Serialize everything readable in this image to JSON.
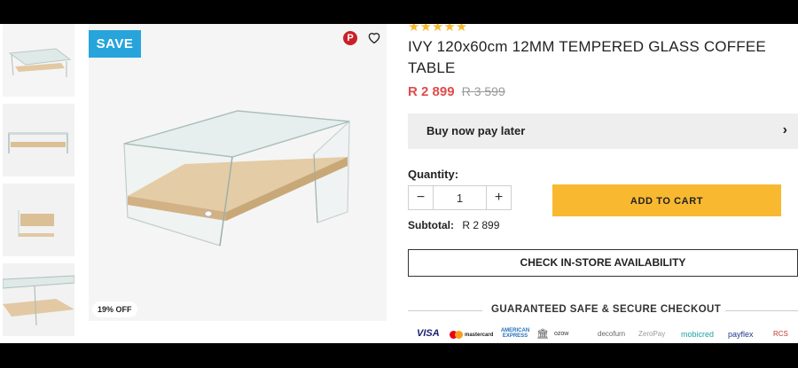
{
  "product": {
    "rating_stars": "★★★★★",
    "title": "IVY 120x60cm 12MM TEMPERED GLASS COFFEE TABLE",
    "price_current": "R 2 899",
    "price_original": "R 3 599",
    "save_badge": "SAVE",
    "discount_badge": "19% OFF"
  },
  "payment_later": {
    "label": "Buy now pay later",
    "chevron": "›"
  },
  "quantity": {
    "label": "Quantity:",
    "value": "1",
    "minus": "−",
    "plus": "+"
  },
  "cart": {
    "add_label": "ADD TO CART",
    "subtotal_label": "Subtotal:",
    "subtotal_value": "R 2 899"
  },
  "store": {
    "check_label": "CHECK IN-STORE AVAILABILITY"
  },
  "checkout": {
    "secure_label": "GUARANTEED SAFE & SECURE CHECKOUT",
    "logos": {
      "visa": "VISA",
      "mastercard": "mastercard",
      "amex": "AMERICAN EXPRESS",
      "ozow": "ozow",
      "decofurn": "decofurn",
      "zeropay": "ZeroPay",
      "mobicred": "mobicred",
      "payflex": "payflex",
      "rcs": "RCS"
    }
  },
  "icons": {
    "pinterest": "pinterest-icon",
    "wishlist": "heart-icon"
  },
  "colors": {
    "price_red": "#e14b4b",
    "save_blue": "#27a4db",
    "cart_yellow": "#f8b931",
    "star_gold": "#f5b82e"
  }
}
